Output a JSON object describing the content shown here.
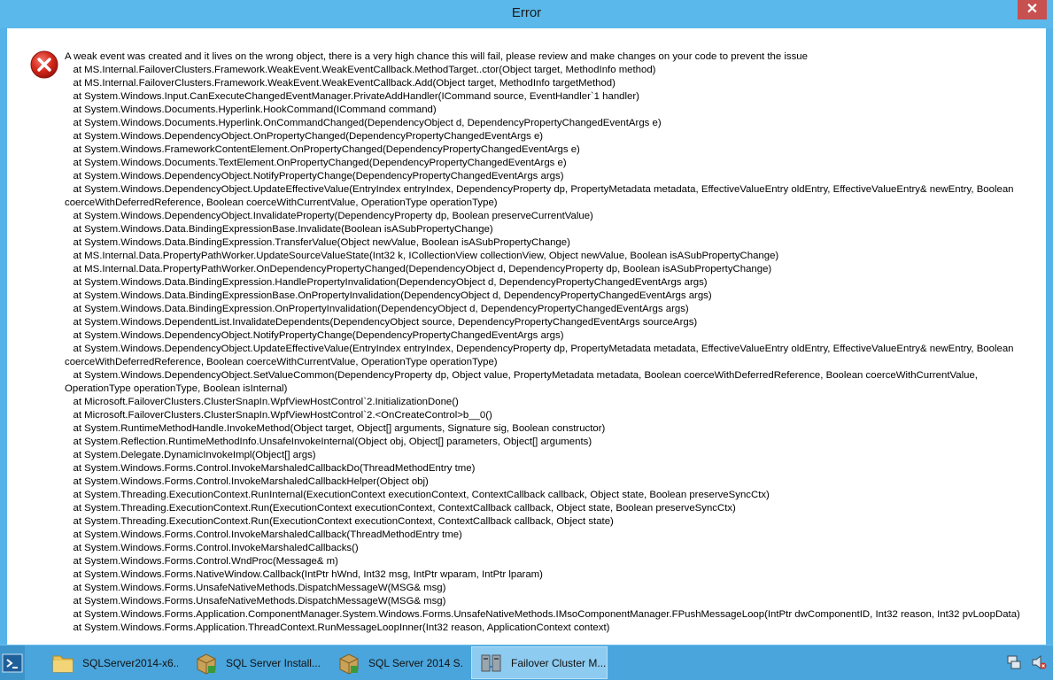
{
  "dialog": {
    "title": "Error",
    "close_label": "✕",
    "message_lines": [
      {
        "text": "A weak event was created and it lives on the wrong object, there is a very high chance this will fail, please review and make changes on your code to prevent the issue"
      },
      {
        "text": "   at MS.Internal.FailoverClusters.Framework.WeakEvent.WeakEventCallback.MethodTarget..ctor(Object target, MethodInfo method)"
      },
      {
        "text": "   at MS.Internal.FailoverClusters.Framework.WeakEvent.WeakEventCallback.Add(Object target, MethodInfo targetMethod)"
      },
      {
        "text": "   at System.Windows.Input.CanExecuteChangedEventManager.PrivateAddHandler(ICommand source, EventHandler`1 handler)"
      },
      {
        "text": "   at System.Windows.Documents.Hyperlink.HookCommand(ICommand command)"
      },
      {
        "text": "   at System.Windows.Documents.Hyperlink.OnCommandChanged(DependencyObject d, DependencyPropertyChangedEventArgs e)"
      },
      {
        "text": "   at System.Windows.DependencyObject.OnPropertyChanged(DependencyPropertyChangedEventArgs e)"
      },
      {
        "text": "   at System.Windows.FrameworkContentElement.OnPropertyChanged(DependencyPropertyChangedEventArgs e)"
      },
      {
        "text": "   at System.Windows.Documents.TextElement.OnPropertyChanged(DependencyPropertyChangedEventArgs e)"
      },
      {
        "text": "   at System.Windows.DependencyObject.NotifyPropertyChange(DependencyPropertyChangedEventArgs args)"
      },
      {
        "text": "   at System.Windows.DependencyObject.UpdateEffectiveValue(EntryIndex entryIndex, DependencyProperty dp, PropertyMetadata metadata, EffectiveValueEntry oldEntry, EffectiveValueEntry& newEntry, Boolean coerceWithDeferredReference, Boolean coerceWithCurrentValue, OperationType operationType)",
        "wrap": true
      },
      {
        "text": "   at System.Windows.DependencyObject.InvalidateProperty(DependencyProperty dp, Boolean preserveCurrentValue)"
      },
      {
        "text": "   at System.Windows.Data.BindingExpressionBase.Invalidate(Boolean isASubPropertyChange)"
      },
      {
        "text": "   at System.Windows.Data.BindingExpression.TransferValue(Object newValue, Boolean isASubPropertyChange)"
      },
      {
        "text": "   at MS.Internal.Data.PropertyPathWorker.UpdateSourceValueState(Int32 k, ICollectionView collectionView, Object newValue, Boolean isASubPropertyChange)"
      },
      {
        "text": "   at MS.Internal.Data.PropertyPathWorker.OnDependencyPropertyChanged(DependencyObject d, DependencyProperty dp, Boolean isASubPropertyChange)"
      },
      {
        "text": "   at System.Windows.Data.BindingExpression.HandlePropertyInvalidation(DependencyObject d, DependencyPropertyChangedEventArgs args)"
      },
      {
        "text": "   at System.Windows.Data.BindingExpressionBase.OnPropertyInvalidation(DependencyObject d, DependencyPropertyChangedEventArgs args)"
      },
      {
        "text": "   at System.Windows.Data.BindingExpression.OnPropertyInvalidation(DependencyObject d, DependencyPropertyChangedEventArgs args)"
      },
      {
        "text": "   at System.Windows.DependentList.InvalidateDependents(DependencyObject source, DependencyPropertyChangedEventArgs sourceArgs)"
      },
      {
        "text": "   at System.Windows.DependencyObject.NotifyPropertyChange(DependencyPropertyChangedEventArgs args)"
      },
      {
        "text": "   at System.Windows.DependencyObject.UpdateEffectiveValue(EntryIndex entryIndex, DependencyProperty dp, PropertyMetadata metadata, EffectiveValueEntry oldEntry, EffectiveValueEntry& newEntry, Boolean coerceWithDeferredReference, Boolean coerceWithCurrentValue, OperationType operationType)",
        "wrap": true
      },
      {
        "text": "   at System.Windows.DependencyObject.SetValueCommon(DependencyProperty dp, Object value, PropertyMetadata metadata, Boolean coerceWithDeferredReference, Boolean coerceWithCurrentValue, OperationType operationType, Boolean isInternal)",
        "wrap": true
      },
      {
        "text": "   at Microsoft.FailoverClusters.ClusterSnapIn.WpfViewHostControl`2.InitializationDone()"
      },
      {
        "text": "   at Microsoft.FailoverClusters.ClusterSnapIn.WpfViewHostControl`2.<OnCreateControl>b__0()"
      },
      {
        "text": "   at System.RuntimeMethodHandle.InvokeMethod(Object target, Object[] arguments, Signature sig, Boolean constructor)"
      },
      {
        "text": "   at System.Reflection.RuntimeMethodInfo.UnsafeInvokeInternal(Object obj, Object[] parameters, Object[] arguments)"
      },
      {
        "text": "   at System.Delegate.DynamicInvokeImpl(Object[] args)"
      },
      {
        "text": "   at System.Windows.Forms.Control.InvokeMarshaledCallbackDo(ThreadMethodEntry tme)"
      },
      {
        "text": "   at System.Windows.Forms.Control.InvokeMarshaledCallbackHelper(Object obj)"
      },
      {
        "text": "   at System.Threading.ExecutionContext.RunInternal(ExecutionContext executionContext, ContextCallback callback, Object state, Boolean preserveSyncCtx)"
      },
      {
        "text": "   at System.Threading.ExecutionContext.Run(ExecutionContext executionContext, ContextCallback callback, Object state, Boolean preserveSyncCtx)"
      },
      {
        "text": "   at System.Threading.ExecutionContext.Run(ExecutionContext executionContext, ContextCallback callback, Object state)"
      },
      {
        "text": "   at System.Windows.Forms.Control.InvokeMarshaledCallback(ThreadMethodEntry tme)"
      },
      {
        "text": "   at System.Windows.Forms.Control.InvokeMarshaledCallbacks()"
      },
      {
        "text": "   at System.Windows.Forms.Control.WndProc(Message& m)"
      },
      {
        "text": "   at System.Windows.Forms.NativeWindow.Callback(IntPtr hWnd, Int32 msg, IntPtr wparam, IntPtr lparam)"
      },
      {
        "text": "   at System.Windows.Forms.UnsafeNativeMethods.DispatchMessageW(MSG& msg)"
      },
      {
        "text": "   at System.Windows.Forms.UnsafeNativeMethods.DispatchMessageW(MSG& msg)"
      },
      {
        "text": "   at System.Windows.Forms.Application.ComponentManager.System.Windows.Forms.UnsafeNativeMethods.IMsoComponentManager.FPushMessageLoop(IntPtr dwComponentID, Int32 reason, Int32 pvLoopData)",
        "wrap": true
      },
      {
        "text": "   at System.Windows.Forms.Application.ThreadContext.RunMessageLoopInner(Int32 reason, ApplicationContext context)"
      }
    ],
    "icon": "error-icon"
  },
  "taskbar": {
    "items": [
      {
        "label": "SQLServer2014-x6...",
        "icon": "folder-icon",
        "active": false
      },
      {
        "label": "SQL Server Install...",
        "icon": "installer-icon",
        "active": false
      },
      {
        "label": "SQL Server 2014 S...",
        "icon": "installer-icon",
        "active": false
      },
      {
        "label": "Failover Cluster M...",
        "icon": "cluster-manager-icon",
        "active": true
      }
    ],
    "tray": [
      {
        "icon": "network-icon"
      },
      {
        "icon": "speaker-muted-icon"
      }
    ],
    "colors": {
      "taskbar": "#4aa5dc",
      "active_item": "#8dcbf0",
      "close_button": "#c75050"
    }
  }
}
